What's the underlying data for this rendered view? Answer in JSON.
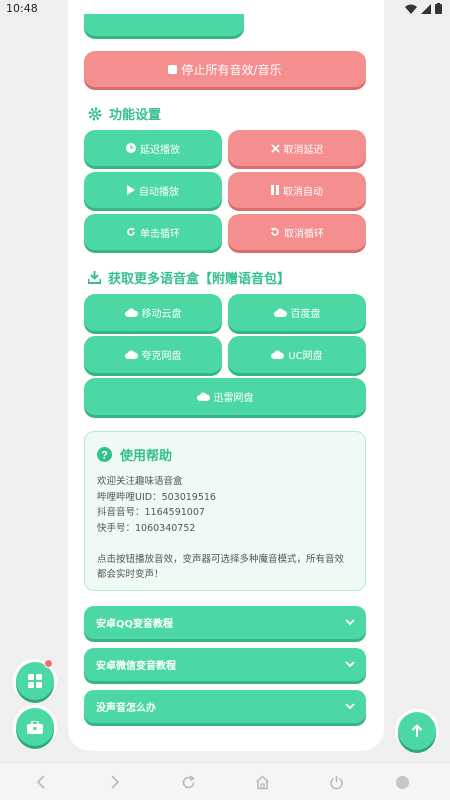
{
  "status_bar": {
    "time": "10:48"
  },
  "controls": {
    "stop_all_label": "停止所有音效/音乐"
  },
  "function_settings": {
    "title": "功能设置",
    "buttons": [
      {
        "label": "延迟播放",
        "icon": "clock-icon"
      },
      {
        "label": "取消延迟",
        "icon": "x-icon"
      },
      {
        "label": "自动播放",
        "icon": "play-icon"
      },
      {
        "label": "取消自动",
        "icon": "pause-icon"
      },
      {
        "label": "单击循环",
        "icon": "redo-icon"
      },
      {
        "label": "取消循环",
        "icon": "undo-icon"
      }
    ]
  },
  "downloads": {
    "title": "获取更多语音盒【附赠语音包】",
    "buttons": [
      {
        "label": "移动云盘"
      },
      {
        "label": "百度盘"
      },
      {
        "label": "夸克网盘"
      },
      {
        "label": "UC网盘"
      },
      {
        "label": "迅雷网盘"
      }
    ]
  },
  "help": {
    "title": "使用帮助",
    "lines": [
      "欢迎关注趣味语音盒",
      "哔哩哔哩UID：503019516",
      "抖音音号：1164591007",
      "快手号：1060340752",
      "",
      "点击按钮播放音效，变声器可选择多种魔音模式，所有音效",
      "都会实时变声！"
    ]
  },
  "accordion": [
    {
      "label": "安卓QQ变音教程"
    },
    {
      "label": "安卓微信变音教程"
    },
    {
      "label": "没声音怎么办"
    }
  ],
  "colors": {
    "primary_green": "#4cd8a3",
    "danger_red": "#f58f8f",
    "title_green": "#34c08c",
    "badge_red": "#f26d6d"
  }
}
